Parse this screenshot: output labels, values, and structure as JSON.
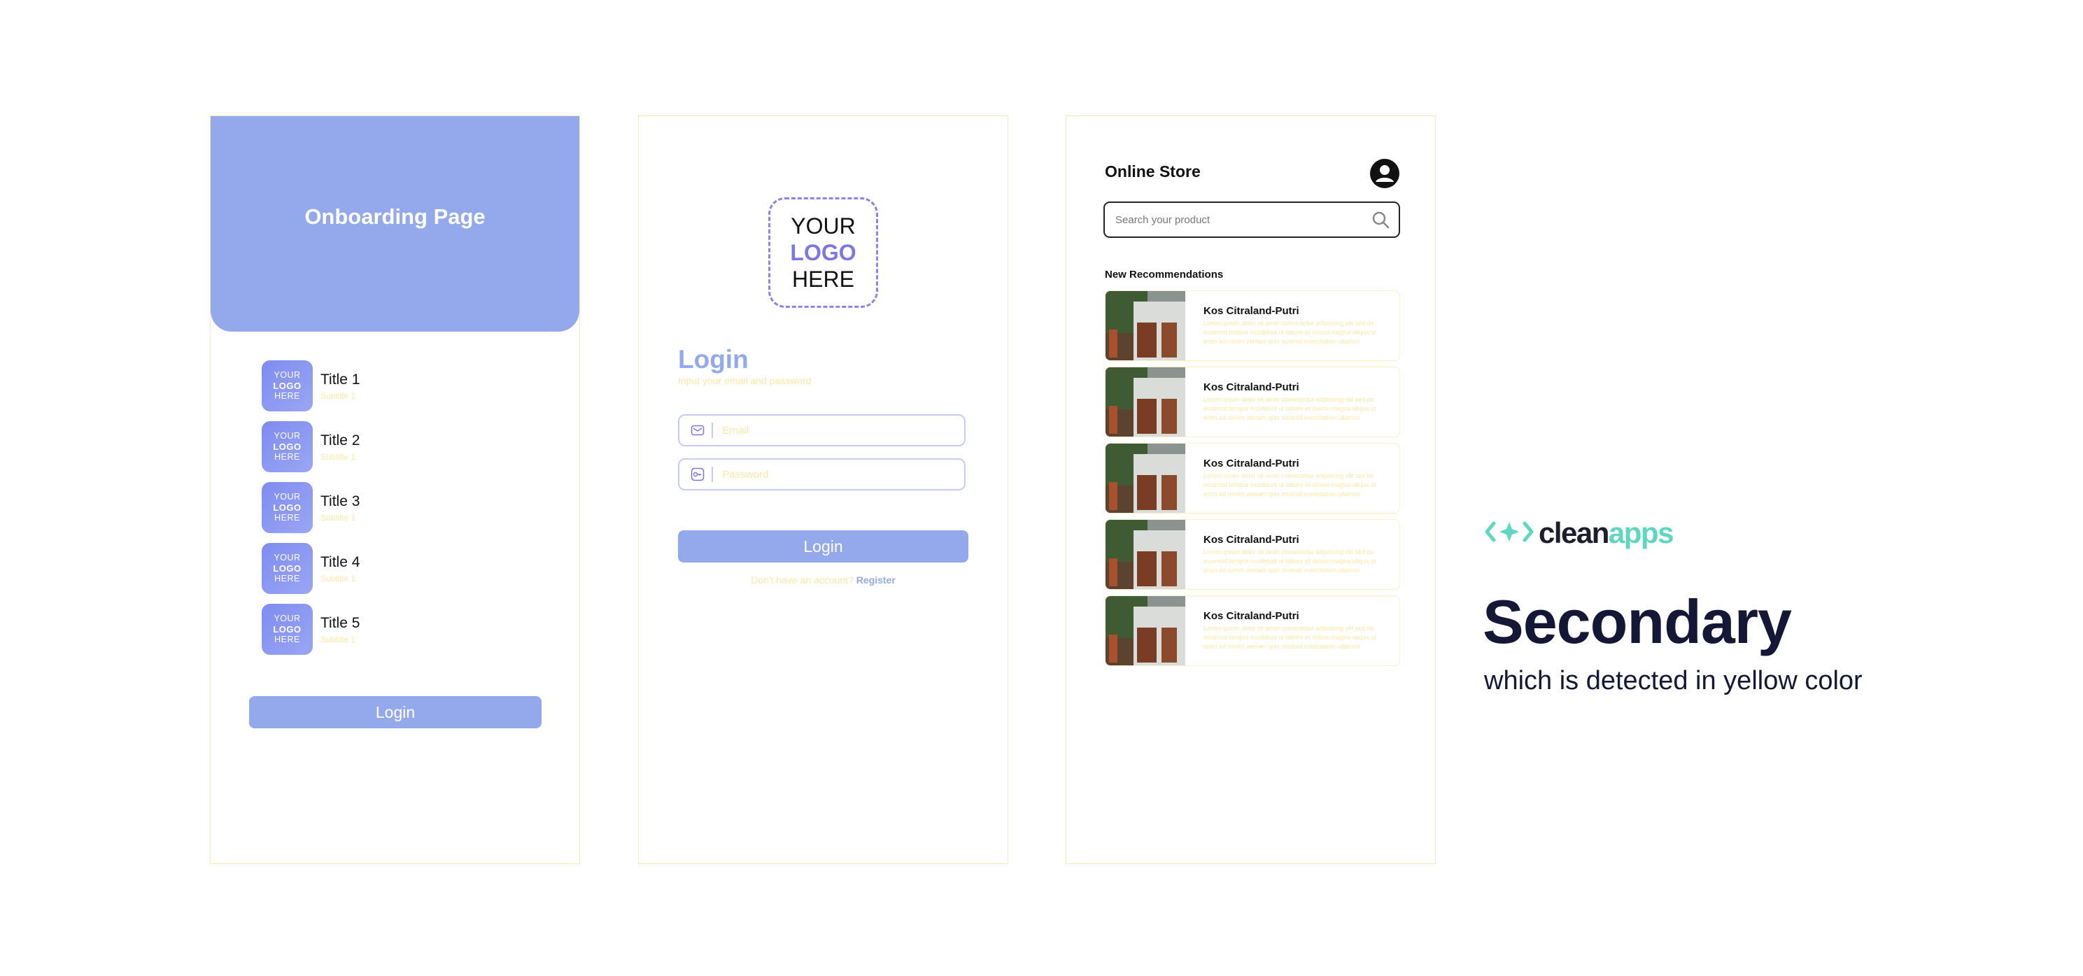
{
  "onboarding": {
    "header_title": "Onboarding Page",
    "logo_tile": {
      "line1": "YOUR",
      "line2": "LOGO",
      "line3": "HERE"
    },
    "items": [
      {
        "title": "Title 1",
        "subtitle": "Subtitle 1"
      },
      {
        "title": "Title 2",
        "subtitle": "Subtitle 1"
      },
      {
        "title": "Title 3",
        "subtitle": "Subtitle 1"
      },
      {
        "title": "Title 4",
        "subtitle": "Subtitle 1"
      },
      {
        "title": "Title 5",
        "subtitle": "Subtitle 1"
      }
    ],
    "login_button": "Login"
  },
  "login": {
    "logo": {
      "line1": "YOUR",
      "line2": "LOGO",
      "line3": "HERE"
    },
    "heading": "Login",
    "subheading": "Input your email and password",
    "email_placeholder": "Email",
    "password_placeholder": "Password",
    "login_button": "Login",
    "register_prompt": "Don't have an account?",
    "register_link": "Register"
  },
  "store": {
    "title": "Online Store",
    "search_placeholder": "Search your product",
    "section_title": "New Recommendations",
    "items": [
      {
        "name": "Kos Citraland-Putri",
        "description": "Lorem ipsum dolor sit amet consectetur adipiscing elit sed do eiusmod tempor incididunt ut labore et dolore magna aliqua ut enim ad minim veniam quis nostrud exercitation ullamco"
      },
      {
        "name": "Kos Citraland-Putri",
        "description": "Lorem ipsum dolor sit amet consectetur adipiscing elit sed do eiusmod tempor incididunt ut labore et dolore magna aliqua ut enim ad minim veniam quis nostrud exercitation ullamco"
      },
      {
        "name": "Kos Citraland-Putri",
        "description": "Lorem ipsum dolor sit amet consectetur adipiscing elit sed do eiusmod tempor incididunt ut labore et dolore magna aliqua ut enim ad minim veniam quis nostrud exercitation ullamco"
      },
      {
        "name": "Kos Citraland-Putri",
        "description": "Lorem ipsum dolor sit amet consectetur adipiscing elit sed do eiusmod tempor incididunt ut labore et dolore magna aliqua ut enim ad minim veniam quis nostrud exercitation ullamco"
      },
      {
        "name": "Kos Citraland-Putri",
        "description": "Lorem ipsum dolor sit amet consectetur adipiscing elit sed do eiusmod tempor incididunt ut labore et dolore magna aliqua ut enim ad minim veniam quis nostrud exercitation ullamco"
      }
    ]
  },
  "branding": {
    "logo_part1": "clean",
    "logo_part2": "apps",
    "headline": "Secondary",
    "caption": "which is detected in yellow color"
  },
  "colors": {
    "primary": "#94a9eb",
    "secondary": "#fde8a6",
    "accent": "#7d77e0",
    "brand_teal": "#5fd7c0"
  },
  "icons": [
    "mail-icon",
    "key-icon",
    "search-icon",
    "user-avatar-icon",
    "cleanapps-logo-icon"
  ]
}
